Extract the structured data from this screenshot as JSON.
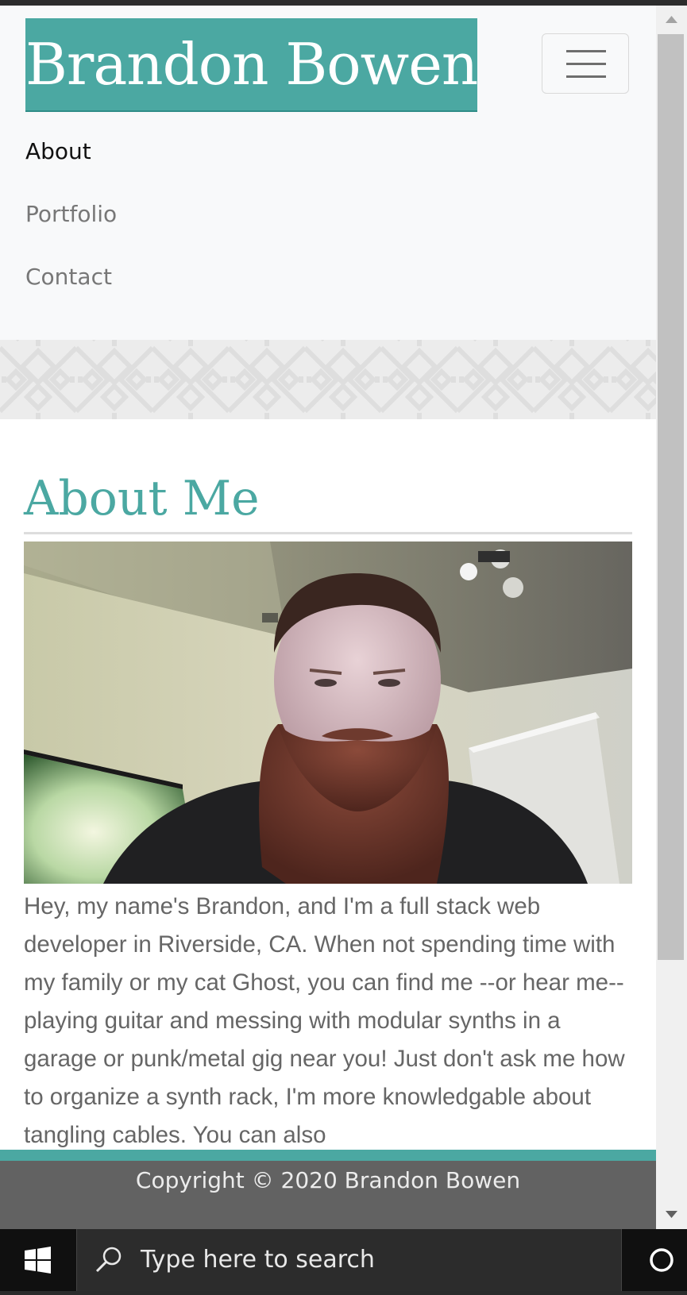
{
  "brand": {
    "name": "Brandon Bowen"
  },
  "nav": {
    "items": [
      {
        "label": "About",
        "active": true
      },
      {
        "label": "Portfolio",
        "active": false
      },
      {
        "label": "Contact",
        "active": false
      }
    ]
  },
  "about": {
    "heading": "About Me",
    "bio": "Hey, my name's Brandon, and I'm a full stack web developer in Riverside, CA. When not spending time with my family or my cat Ghost, you can find me --or hear me-- playing guitar and messing with modular synths in a garage or punk/metal gig near you! Just don't ask me how to organize a synth rack, I'm more knowledgable about tangling cables. You can also"
  },
  "footer": {
    "copyright": "Copyright © 2020 Brandon Bowen"
  },
  "taskbar": {
    "search_placeholder": "Type here to search"
  },
  "colors": {
    "accent": "#4ba8a2",
    "navbar_bg": "#f8f9fa",
    "footer_bg": "#626262",
    "text_muted": "#666666"
  },
  "icons": [
    "hamburger-menu-icon",
    "windows-start-icon",
    "search-icon",
    "cortana-icon",
    "scroll-up-arrow-icon",
    "scroll-down-arrow-icon"
  ]
}
